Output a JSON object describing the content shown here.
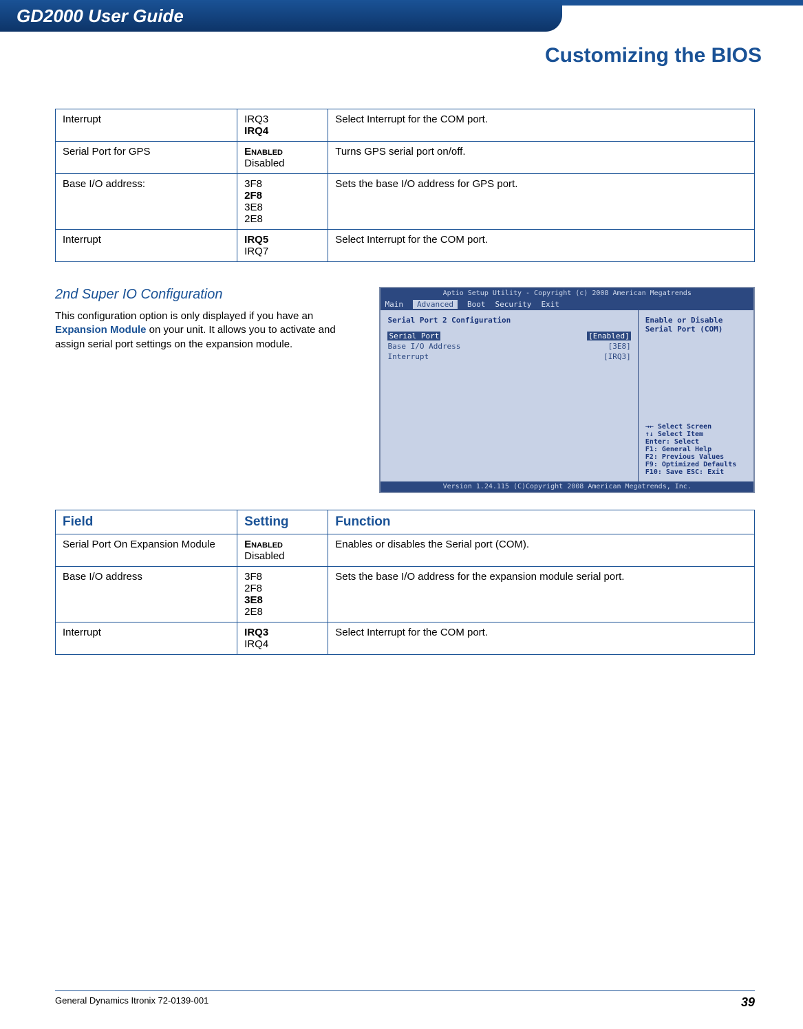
{
  "header": {
    "title": "GD2000 User Guide"
  },
  "section": {
    "title": "Customizing the BIOS"
  },
  "table1": {
    "rows": [
      {
        "field": "Interrupt",
        "settings": [
          "IRQ3",
          "IRQ4"
        ],
        "bold_index": 1,
        "function": "Select Interrupt for the COM port."
      },
      {
        "field": "Serial Port for GPS",
        "settings": [
          "Enabled",
          "Disabled"
        ],
        "bold_index": 0,
        "smallcaps_index": 0,
        "function": "Turns GPS serial port on/off."
      },
      {
        "field": "Base I/O address:",
        "settings": [
          "3F8",
          "2F8",
          "3E8",
          "2E8"
        ],
        "bold_index": 1,
        "function": "Sets the base I/O address for GPS port."
      },
      {
        "field": "Interrupt",
        "settings": [
          "IRQ5",
          "IRQ7"
        ],
        "bold_index": 0,
        "function": "Select Interrupt for the COM port."
      }
    ]
  },
  "subsection": {
    "heading": "2nd Super IO Configuration",
    "body_pre": "This configuration option is only displayed if you have an ",
    "body_link": "Expansion Module",
    "body_post": " on your unit.  It allows you to activate and assign serial port settings on the expansion module."
  },
  "bios": {
    "top": "Aptio Setup Utility - Copyright (c) 2008 American Megatrends",
    "tabs": [
      "Main",
      "Advanced",
      "Boot",
      "Security",
      "Exit"
    ],
    "active_tab": "Advanced",
    "panel_title": "Serial Port 2 Configuration",
    "items": [
      {
        "label": "Serial Port",
        "value": "[Enabled]"
      },
      {
        "label": "Base I/O Address",
        "value": "[3E8]"
      },
      {
        "label": "Interrupt",
        "value": "[IRQ3]"
      }
    ],
    "right_desc": "Enable or Disable Serial Port (COM)",
    "help": [
      "→←  Select Screen",
      "↑↓  Select Item",
      "Enter: Select",
      "F1: General Help",
      "F2: Previous Values",
      "F9: Optimized Defaults",
      "F10: Save ESC: Exit"
    ],
    "bottom": "Version 1.24.115  (C)Copyright 2008 American Megatrends, Inc."
  },
  "table2": {
    "headers": {
      "field": "Field",
      "setting": "Setting",
      "function": "Function"
    },
    "rows": [
      {
        "field": "Serial Port On Expansion Module",
        "settings": [
          "Enabled",
          "Disabled"
        ],
        "bold_index": 0,
        "smallcaps_index": 0,
        "function": "Enables or disables the Serial port (COM)."
      },
      {
        "field": "Base I/O address",
        "settings": [
          "3F8",
          "2F8",
          "3E8",
          "2E8"
        ],
        "bold_index": 2,
        "function": "Sets the base I/O address for the expansion module serial port."
      },
      {
        "field": "Interrupt",
        "settings": [
          "IRQ3",
          "IRQ4"
        ],
        "bold_index": 0,
        "function": "Select Interrupt for the COM port."
      }
    ]
  },
  "footer": {
    "left": "General Dynamics Itronix 72-0139-001",
    "right": "39"
  }
}
